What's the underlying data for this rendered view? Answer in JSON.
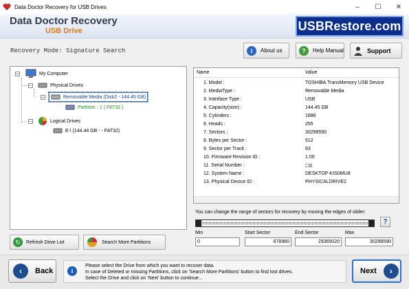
{
  "window": {
    "title": "Data Doctor Recovery for USB Drives",
    "controls": {
      "minimize": "–",
      "maximize": "☐",
      "close": "✕"
    }
  },
  "banner": {
    "product_line1": "Data Doctor Recovery",
    "product_line2": "USB Drive",
    "logo": "USBRestore.com"
  },
  "toolbar": {
    "mode": "Recovery Mode: Signature Search",
    "about": "About us",
    "help": "Help Manual",
    "support": "Support"
  },
  "tree": {
    "root": "My Computer",
    "physical": "Physical Drives",
    "removable": "Removable Media (Disk2 - 144.45 GB)",
    "partition": "Partition - 1 ( FAT32 )",
    "logical": "Logical Drives",
    "logical_drive": "E:\\ (144.44 GB -  - FAT32)"
  },
  "details": {
    "col_name": "Name",
    "col_value": "Value",
    "rows": [
      {
        "name": "1. Model :",
        "value": "TOSHIBA TransMemory USB Device"
      },
      {
        "name": "2. MediaType :",
        "value": "Removable Media"
      },
      {
        "name": "3. Interface Type :",
        "value": "USB"
      },
      {
        "name": "4. Capacity(size) :",
        "value": "144.45 GB"
      },
      {
        "name": "5. Cylinders :",
        "value": "1886"
      },
      {
        "name": "6. Heads :",
        "value": "255"
      },
      {
        "name": "7. Sectors :",
        "value": "30298590"
      },
      {
        "name": "8. Bytes per Sector :",
        "value": "512"
      },
      {
        "name": "9. Sector per Track :",
        "value": "63"
      },
      {
        "name": "10. Firmware Revision ID :",
        "value": "1.00"
      },
      {
        "name": "11. Serial Number :",
        "value": "☐0"
      },
      {
        "name": "12. System Name :",
        "value": "DESKTOP-KIS0MU8"
      },
      {
        "name": "13. Physical Device ID :",
        "value": "PHYSICALDRIVE2"
      }
    ]
  },
  "sectors": {
    "hint": "You can change the range of sectors for recovery by moving the edges of slider:",
    "min_label": "Min",
    "min": "0",
    "start_label": "Start Sector",
    "start": "678960",
    "end_label": "End Sector",
    "end": "29365020",
    "max_label": "Max",
    "max": "30298590",
    "help": "?"
  },
  "actions": {
    "refresh": "Refresh Drive List",
    "search_more": "Search More Partitions"
  },
  "footer": {
    "back": "Back",
    "next": "Next",
    "msg1": "Please select the Drive from which you want to recover data.",
    "msg2": "In case of Deleted or missing Partitions, click on 'Search More Partitions' button to find lost drives.",
    "msg3": "Select the Drive and click on 'Next' button to continue..."
  },
  "colors": {
    "accent": "#1d4d8f",
    "brand_orange": "#e07b1a",
    "selection": "#2a6edc",
    "partition_text": "#2a8a2a"
  }
}
